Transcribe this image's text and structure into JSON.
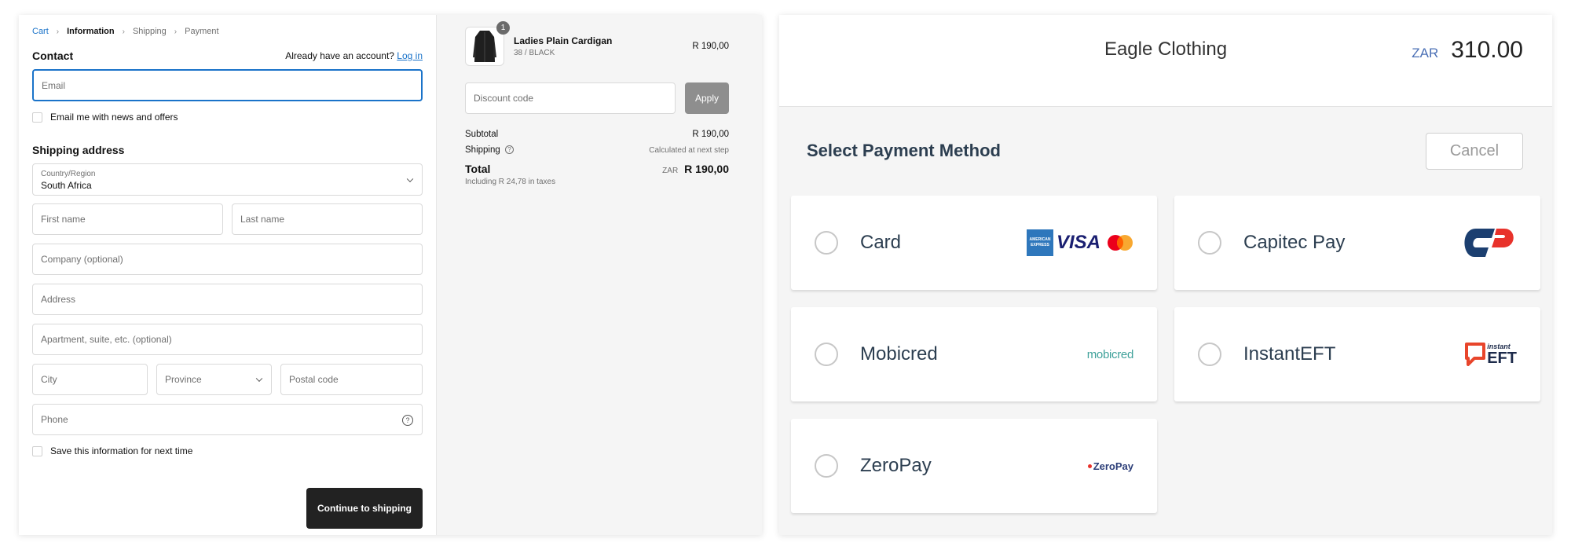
{
  "checkout": {
    "breadcrumb": [
      "Cart",
      "Information",
      "Shipping",
      "Payment"
    ],
    "contact": {
      "heading": "Contact",
      "account_prompt": "Already have an account?",
      "login_link": "Log in",
      "email_placeholder": "Email",
      "newsletter_label": "Email me with news and offers"
    },
    "shipping": {
      "heading": "Shipping address",
      "country_label": "Country/Region",
      "country_value": "South Africa",
      "first_name": "First name",
      "last_name": "Last name",
      "company": "Company (optional)",
      "address": "Address",
      "apartment": "Apartment, suite, etc. (optional)",
      "city": "City",
      "province": "Province",
      "postal": "Postal code",
      "phone": "Phone",
      "save_label": "Save this information for next time",
      "continue_button": "Continue to shipping"
    }
  },
  "summary": {
    "product": {
      "name": "Ladies Plain Cardigan",
      "variant": "38 / BLACK",
      "price": "R 190,00",
      "quantity": "1"
    },
    "discount_placeholder": "Discount code",
    "apply_button": "Apply",
    "subtotal_label": "Subtotal",
    "subtotal_value": "R 190,00",
    "shipping_label": "Shipping",
    "shipping_value": "Calculated at next step",
    "total_label": "Total",
    "tax_note": "Including R 24,78 in taxes",
    "currency": "ZAR",
    "total_value": "R 190,00"
  },
  "payment": {
    "merchant": "Eagle Clothing",
    "currency": "ZAR",
    "amount": "310.00",
    "title": "Select Payment Method",
    "cancel_button": "Cancel",
    "methods": [
      {
        "label": "Card",
        "logo": "card-brands-logo"
      },
      {
        "label": "Capitec Pay",
        "logo": "capitec-logo"
      },
      {
        "label": "Mobicred",
        "logo": "mobicred-logo",
        "logo_text": "mobicred"
      },
      {
        "label": "InstantEFT",
        "logo": "instanteft-logo",
        "logo_text_1": "instant",
        "logo_text_2": "EFT"
      },
      {
        "label": "ZeroPay",
        "logo": "zeropay-logo",
        "logo_text": "ZeroPay"
      }
    ],
    "card_logo_texts": {
      "amex": "AMERICAN EXPRESS",
      "visa": "VISA"
    }
  },
  "colors": {
    "link": "#1a73c9",
    "primary_button": "#222222",
    "apply_button": "#8e8e8e",
    "capitec_blue": "#1c3f70",
    "capitec_red": "#e8322b",
    "eft_red": "#e8452b"
  }
}
